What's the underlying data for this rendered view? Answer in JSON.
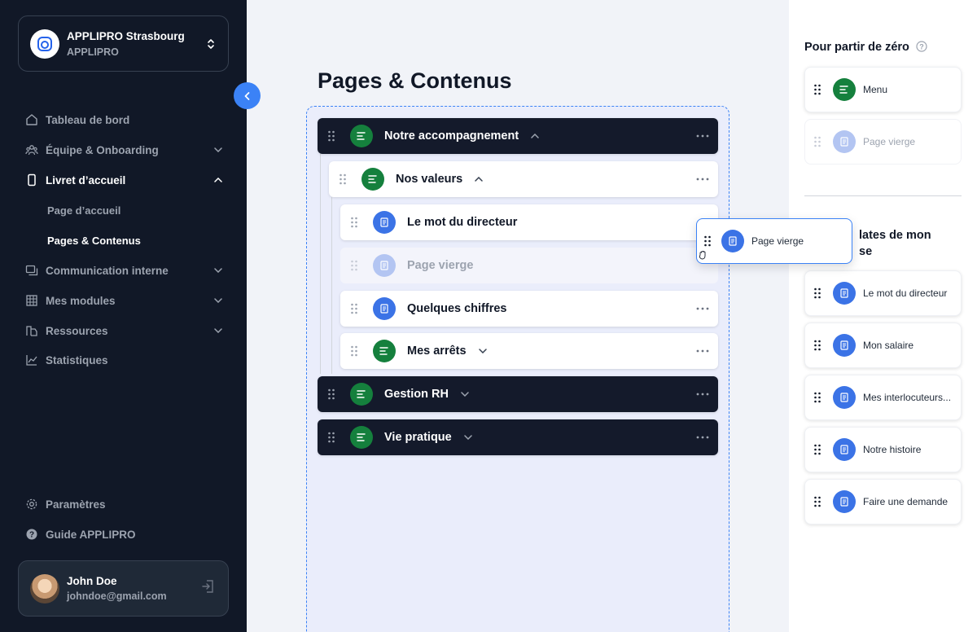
{
  "org": {
    "name": "APPLIPRO Strasbourg",
    "subtitle": "APPLIPRO"
  },
  "nav": {
    "items": [
      {
        "label": "Tableau de bord",
        "icon": "home-icon"
      },
      {
        "label": "Équipe & Onboarding",
        "icon": "team-icon"
      },
      {
        "label": "Livret d’accueil",
        "icon": "phone-icon"
      },
      {
        "label": "Communication interne",
        "icon": "chat-icon"
      },
      {
        "label": "Mes modules",
        "icon": "grid-icon"
      },
      {
        "label": "Ressources",
        "icon": "resources-icon"
      },
      {
        "label": "Statistiques",
        "icon": "chart-icon"
      }
    ],
    "sub_items": [
      "Page d’accueil",
      "Pages & Contenus"
    ],
    "bottom": [
      {
        "label": "Paramètres",
        "icon": "gear-icon"
      },
      {
        "label": "Guide APPLIPRO",
        "icon": "help-icon"
      }
    ]
  },
  "user": {
    "name": "John Doe",
    "email": "johndoe@gmail.com"
  },
  "main": {
    "title": "Pages & Contenus",
    "rows": [
      {
        "label": "Notre accompagnement",
        "kind": "menu"
      },
      {
        "label": "Nos valeurs",
        "kind": "menu"
      },
      {
        "label": "Le mot du directeur",
        "kind": "page"
      },
      {
        "label": "Page vierge",
        "kind": "page-placeholder"
      },
      {
        "label": "Quelques chiffres",
        "kind": "page"
      },
      {
        "label": "Mes arrêts",
        "kind": "menu"
      },
      {
        "label": "Gestion RH",
        "kind": "menu"
      },
      {
        "label": "Vie pratique",
        "kind": "menu"
      }
    ]
  },
  "right_panel": {
    "scratch_title": "Pour partir de zéro",
    "scratch_items": [
      "Menu",
      "Page vierge"
    ],
    "templates_title": "Templates de mon entreprise",
    "templates_title_visible_line1": "lates de mon",
    "templates_title_visible_line2": "se",
    "templates": [
      "Le mot du directeur",
      "Mon salaire",
      "Mes interlocuteurs...",
      "Notre histoire",
      "Faire une demande"
    ]
  },
  "drag_card": {
    "label": "Page vierge"
  },
  "colors": {
    "sidebar": "#111827",
    "accent": "#3b82f6",
    "menu_badge": "#15803d",
    "page_badge": "#3b73e6"
  }
}
